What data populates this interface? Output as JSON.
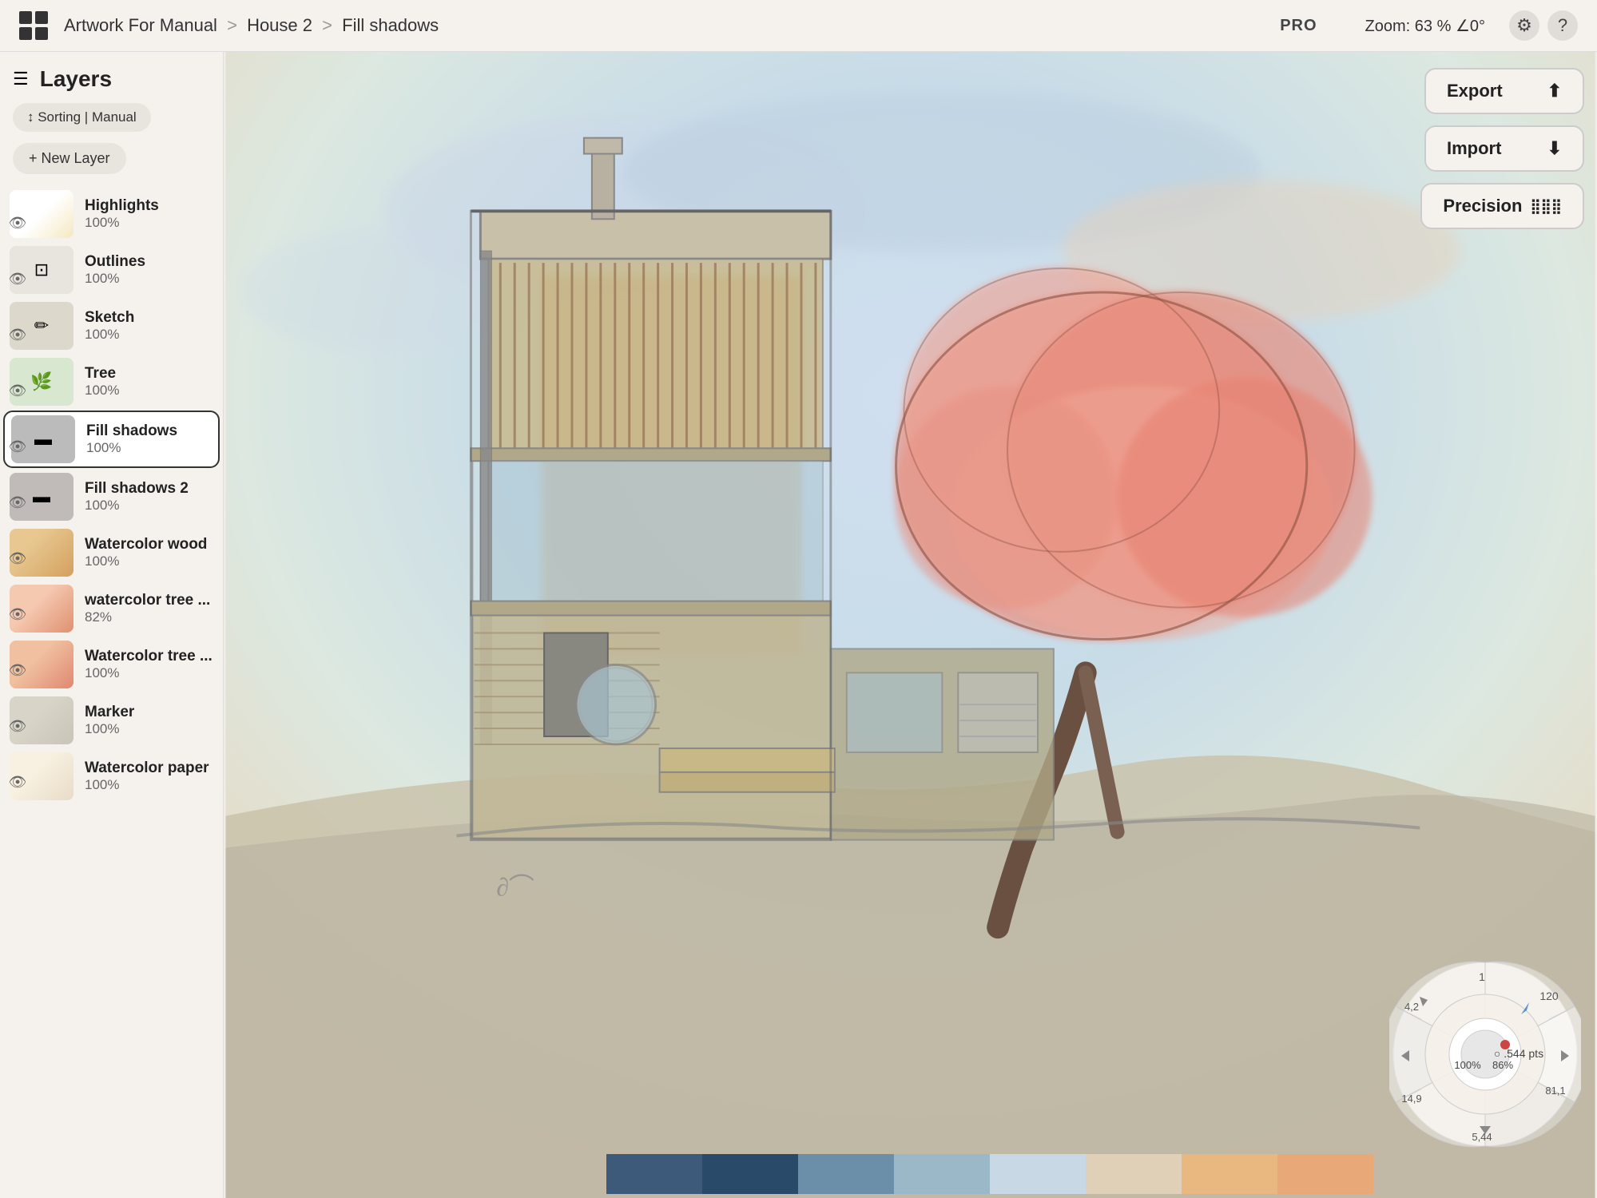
{
  "header": {
    "grid_icon": "grid",
    "breadcrumb": {
      "part1": "Artwork For Manual",
      "sep1": ">",
      "part2": "House 2",
      "sep2": ">",
      "part3": "Fill shadows"
    },
    "pro_label": "PRO",
    "zoom_label": "Zoom:",
    "zoom_value": "63 %",
    "zoom_angle": "∠0°",
    "settings_icon": "⚙",
    "help_icon": "?"
  },
  "left_panel": {
    "menu_icon": "☰",
    "layers_title": "Layers",
    "sorting_label": "↕ Sorting | Manual",
    "new_layer_label": "+ New Layer",
    "layers": [
      {
        "name": "Highlights",
        "opacity": "100%",
        "thumb": "highlights",
        "visible": true,
        "active": false
      },
      {
        "name": "Outlines",
        "opacity": "100%",
        "thumb": "outlines",
        "visible": true,
        "active": false
      },
      {
        "name": "Sketch",
        "opacity": "100%",
        "thumb": "sketch",
        "visible": true,
        "active": false
      },
      {
        "name": "Tree",
        "opacity": "100%",
        "thumb": "tree",
        "visible": true,
        "active": false
      },
      {
        "name": "Fill shadows",
        "opacity": "100%",
        "thumb": "fill-shadows",
        "visible": true,
        "active": true
      },
      {
        "name": "Fill shadows 2",
        "opacity": "100%",
        "thumb": "fill-shadows2",
        "visible": true,
        "active": false
      },
      {
        "name": "Watercolor wood",
        "opacity": "100%",
        "thumb": "watercolor-wood",
        "visible": true,
        "active": false
      },
      {
        "name": "watercolor tree ...",
        "opacity": "82%",
        "thumb": "watercolor-tree1",
        "visible": true,
        "active": false
      },
      {
        "name": "Watercolor tree ...",
        "opacity": "100%",
        "thumb": "watercolor-tree2",
        "visible": true,
        "active": false
      },
      {
        "name": "Marker",
        "opacity": "100%",
        "thumb": "marker",
        "visible": true,
        "active": false
      },
      {
        "name": "Watercolor paper",
        "opacity": "100%",
        "thumb": "watercolor-paper",
        "visible": true,
        "active": false
      }
    ]
  },
  "right_panel": {
    "export_label": "Export",
    "export_icon": "⬆",
    "import_label": "Import",
    "import_icon": "⬇",
    "precision_label": "Precision",
    "precision_icon": "⣿"
  },
  "precision_wheel": {
    "value": ".544 pts",
    "percent1": "100%",
    "percent2": "86%",
    "numbers": [
      "1",
      "120",
      "81,1",
      "5,44",
      "14,9",
      "4,2"
    ]
  },
  "color_palette": {
    "colors": [
      "#3d5a7a",
      "#2a4a6a",
      "#6b8fa8",
      "#9bb8c8",
      "#c8d8e4",
      "#f0d8c0",
      "#e0c8b0",
      "#e8b090"
    ]
  }
}
